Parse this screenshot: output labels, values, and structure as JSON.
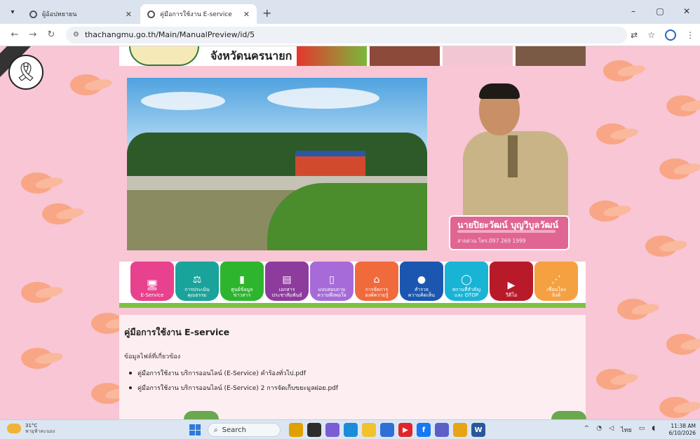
{
  "browser": {
    "tabs": [
      {
        "title": "ผู้อ้อปหยายน",
        "active": false
      },
      {
        "title": "คู่มือการใช้งาน E-service",
        "active": true
      }
    ],
    "url": "thachangmu.go.th/Main/ManualPreview/id/5",
    "window_controls": [
      "–",
      "▢",
      "✕"
    ]
  },
  "header": {
    "province": "จังหวัดนครนายก"
  },
  "profile": {
    "name": "นายปิยะวัฒน์ บุญวิบูลวัฒน์",
    "hotline": "สายด่วน โทร.097 269 1999"
  },
  "menu": {
    "items": [
      {
        "label": "E-Service",
        "icon": "monitor-icon",
        "color": "#e8418e"
      },
      {
        "label": "การประเมิน\nคุณธรรม",
        "icon": "scale-icon",
        "color": "#1aa39a"
      },
      {
        "label": "ศูนย์ข้อมูล\nข่าวสาร",
        "icon": "bar-chart-icon",
        "color": "#2eb52e"
      },
      {
        "label": "เอกสาร\nประชาสัมพันธ์",
        "icon": "book-icon",
        "color": "#8e3b9e"
      },
      {
        "label": "แบบสอบถาม\nความพึงพอใจ",
        "icon": "clipboard-icon",
        "color": "#a66bd9"
      },
      {
        "label": "การจัดการ\nองค์ความรู้",
        "icon": "bank-icon",
        "color": "#f06a3c"
      },
      {
        "label": "สำรวจ\nความคิดเห็น",
        "icon": "chat-icon",
        "color": "#1b57b0"
      },
      {
        "label": "สถานที่สำคัญ\nและ OTOP",
        "icon": "pin-icon",
        "color": "#18b4d6"
      },
      {
        "label": "วีดีโอ",
        "icon": "play-icon",
        "color": "#b81a2a"
      },
      {
        "label": "เชื่อมโยง\nลิงค์",
        "icon": "share-icon",
        "color": "#f5a142"
      }
    ]
  },
  "content": {
    "title": "คู่มือการใช้งาน E-service",
    "related_label": "ข้อมูลไฟล์ที่เกี่ยวข้อง",
    "files": [
      "คู่มือการใช้งาน บริการออนไลน์ (E-Service) คำร้องทั่วไป.pdf",
      "คู่มือการใช้งาน บริการออนไลน์ (E-Service) 2 การจัดเก็บขยะมูลฝอย.pdf"
    ]
  },
  "taskbar": {
    "weather_temp": "31°C",
    "weather_cond": "พายุฟ้าคะนอง",
    "search_label": "Search",
    "lang": "ไทย",
    "time": "11:38 AM",
    "date": "6/10/2026",
    "apps": [
      {
        "icon": "files-icon",
        "color": "#e0a000"
      },
      {
        "icon": "task-view-icon",
        "color": "#2d2d2d"
      },
      {
        "icon": "copilot-icon",
        "color": "#7b5cd6"
      },
      {
        "icon": "edge-icon",
        "color": "#1c8cd8"
      },
      {
        "icon": "folder-icon",
        "color": "#f2c12e"
      },
      {
        "icon": "store-icon",
        "color": "#2f6fd6"
      },
      {
        "icon": "youtube-icon",
        "color": "#e0262b"
      },
      {
        "icon": "facebook-icon",
        "color": "#1877f2"
      },
      {
        "icon": "teams-icon",
        "color": "#5b5fc7"
      },
      {
        "icon": "chrome-icon",
        "color": "#e8a317"
      },
      {
        "icon": "word-icon",
        "color": "#2b579a"
      }
    ]
  }
}
